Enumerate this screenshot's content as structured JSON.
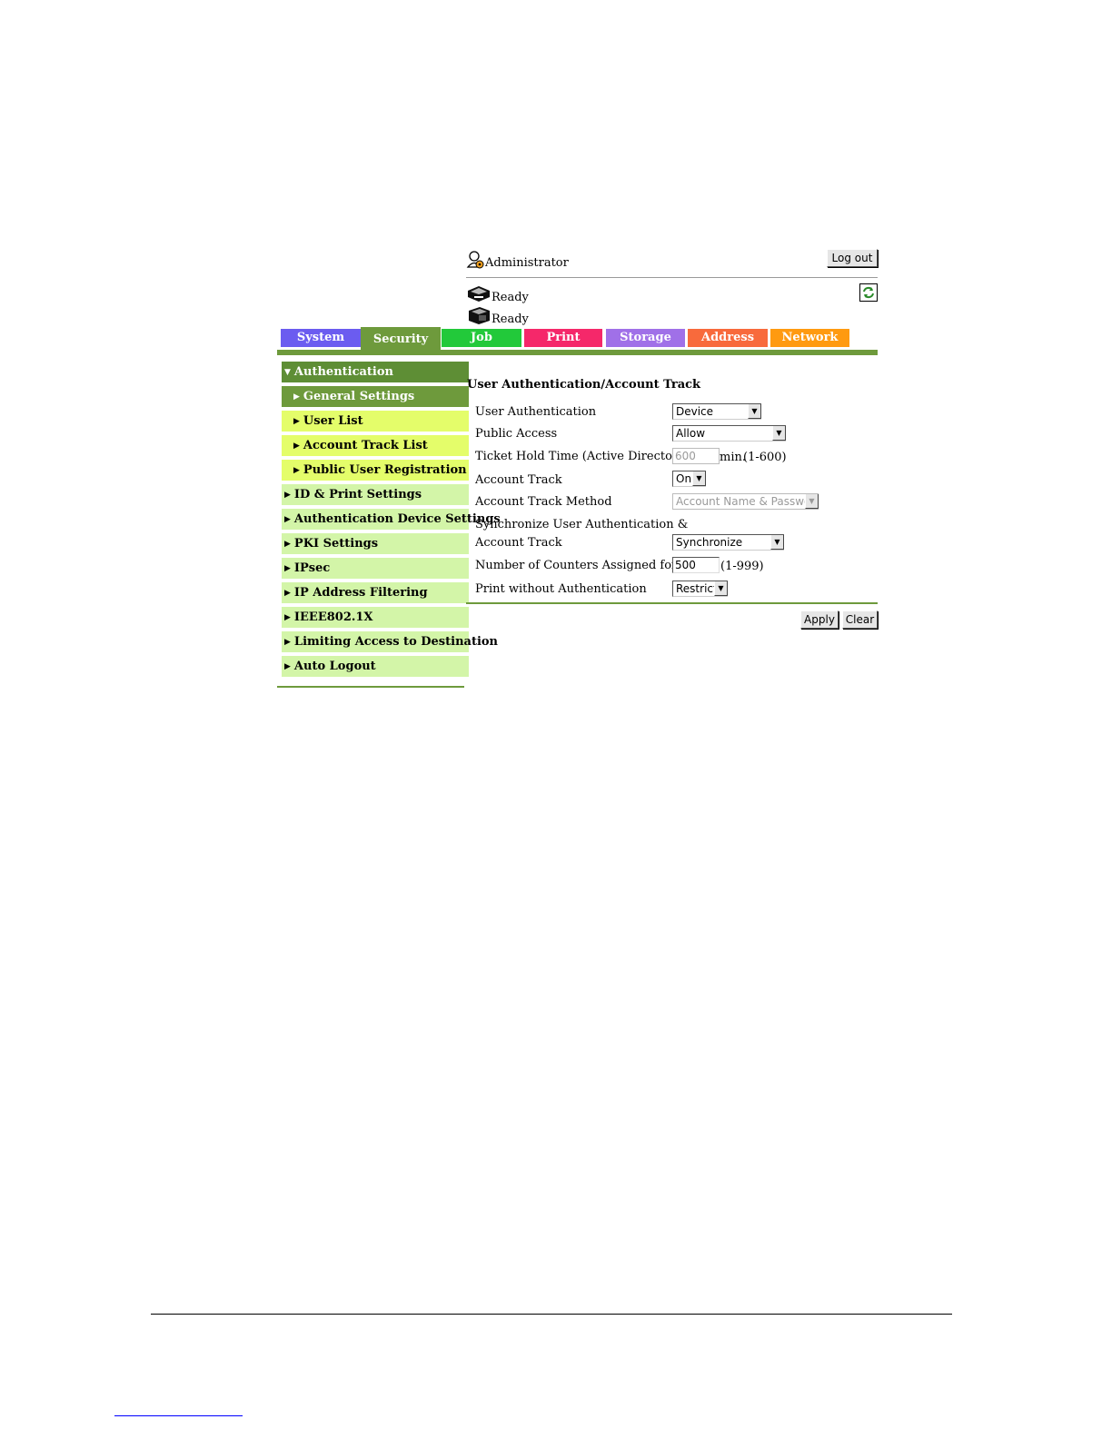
{
  "header": {
    "user_name": "Administrator",
    "logout_label": "Log out",
    "statuses": [
      {
        "label": "Ready",
        "icon": "printer-icon"
      },
      {
        "label": "Ready",
        "icon": "scanner-icon"
      }
    ],
    "refresh_icon": "refresh-icon"
  },
  "tabs": [
    {
      "label": "System",
      "color": "#6b5cf0"
    },
    {
      "label": "Security",
      "color": "#6e9a3c"
    },
    {
      "label": "Job",
      "color": "#22c93a"
    },
    {
      "label": "Print",
      "color": "#f5286a"
    },
    {
      "label": "Storage",
      "color": "#a070e8"
    },
    {
      "label": "Address",
      "color": "#f86a3c"
    },
    {
      "label": "Network",
      "color": "#ff9a10"
    }
  ],
  "sidebar": {
    "items": [
      {
        "label": "Authentication"
      },
      {
        "label": "General Settings"
      },
      {
        "label": "User List"
      },
      {
        "label": "Account Track List"
      },
      {
        "label": "Public User Registration"
      },
      {
        "label": "ID & Print Settings"
      },
      {
        "label": "Authentication Device Settings"
      },
      {
        "label": "PKI Settings"
      },
      {
        "label": "IPsec"
      },
      {
        "label": "IP Address Filtering"
      },
      {
        "label": "IEEE802.1X"
      },
      {
        "label": "Limiting Access to Destination"
      },
      {
        "label": "Auto Logout"
      }
    ]
  },
  "form": {
    "title": "User Authentication/Account Track",
    "user_auth": {
      "label": "User Authentication",
      "value": "Device"
    },
    "public_access": {
      "label": "Public Access",
      "value": "Allow"
    },
    "ticket_hold": {
      "label": "Ticket Hold Time (Active Directory)",
      "value": "600",
      "unit": "min.",
      "range": "(1-600)"
    },
    "account_track": {
      "label": "Account Track",
      "value": "On"
    },
    "account_track_method": {
      "label": "Account Track Method",
      "value": "Account Name & Password"
    },
    "sync": {
      "label_line1": "Synchronize User Authentication &",
      "label_line2": "Account Track",
      "value": "Synchronize"
    },
    "counters": {
      "label": "Number of Counters Assigned for Users",
      "value": "500",
      "range": "(1-999)"
    },
    "print_without_auth": {
      "label": "Print without Authentication",
      "value": "Restrict"
    },
    "apply_label": "Apply",
    "clear_label": "Clear"
  },
  "colors": {
    "accent_green": "#6e9a3c",
    "sidebar_light": "#d3f5a8",
    "sidebar_sub": "#e4fd6a"
  }
}
